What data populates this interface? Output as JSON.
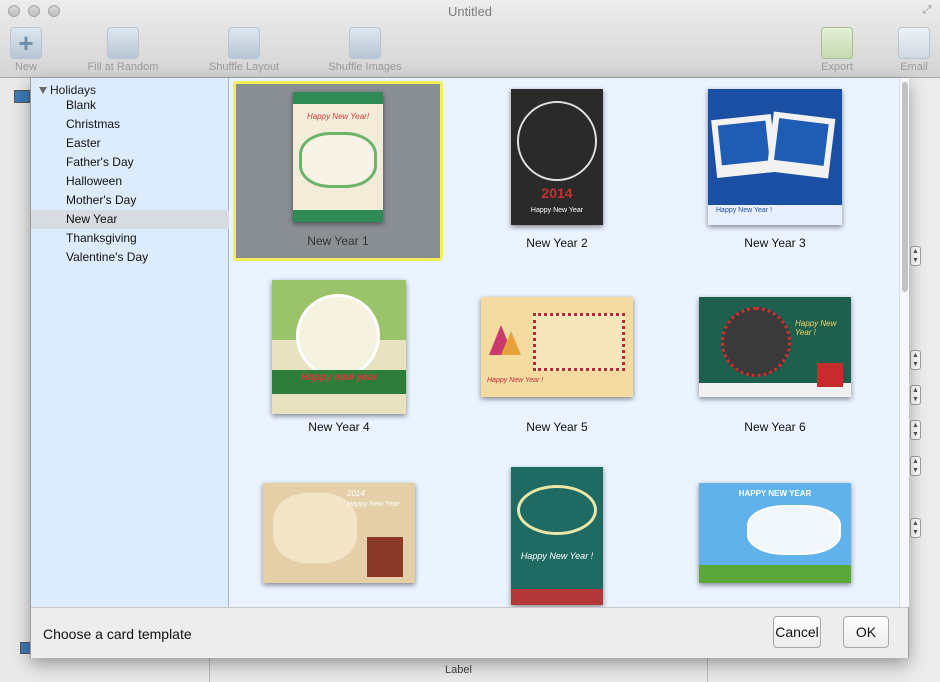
{
  "window": {
    "title": "Untitled"
  },
  "toolbar": {
    "new": "New",
    "fill_random": "Fill at Random",
    "shuffle_layout": "Shuffle Layout",
    "shuffle_images": "Shuffle Images",
    "export": "Export",
    "email": "Email"
  },
  "sidebar": {
    "group": "Holidays",
    "items": [
      {
        "label": "Blank"
      },
      {
        "label": "Christmas"
      },
      {
        "label": "Easter"
      },
      {
        "label": "Father's Day"
      },
      {
        "label": "Halloween"
      },
      {
        "label": "Mother's Day"
      },
      {
        "label": "New Year"
      },
      {
        "label": "Thanksgiving"
      },
      {
        "label": "Valentine's Day"
      }
    ],
    "selected": "New Year"
  },
  "templates": [
    {
      "name": "New Year 1",
      "card_text": "Happy New Year!",
      "selected": true
    },
    {
      "name": "New Year 2",
      "card_text": "Happy New Year",
      "card_year": "2014"
    },
    {
      "name": "New Year 3",
      "card_text": "Happy New Year !"
    },
    {
      "name": "New Year 4",
      "card_text": "Happy new year"
    },
    {
      "name": "New Year 5",
      "card_text": "Happy New Year !"
    },
    {
      "name": "New Year 6",
      "card_text": "Happy New Year !"
    },
    {
      "name": "",
      "card_text": "Happy New Year",
      "card_year": "2014"
    },
    {
      "name": "",
      "card_text": "Happy New Year !"
    },
    {
      "name": "",
      "card_text": "HAPPY NEW YEAR"
    }
  ],
  "footer": {
    "hint": "Choose a card template",
    "cancel": "Cancel",
    "ok": "OK"
  },
  "background": {
    "label": "Label"
  },
  "colors": {
    "sidebar_bg": "#ddecfd",
    "grid_bg": "#eaf3ff",
    "selection_border": "#f1ee5b",
    "selection_fill": "#8a8f94"
  }
}
